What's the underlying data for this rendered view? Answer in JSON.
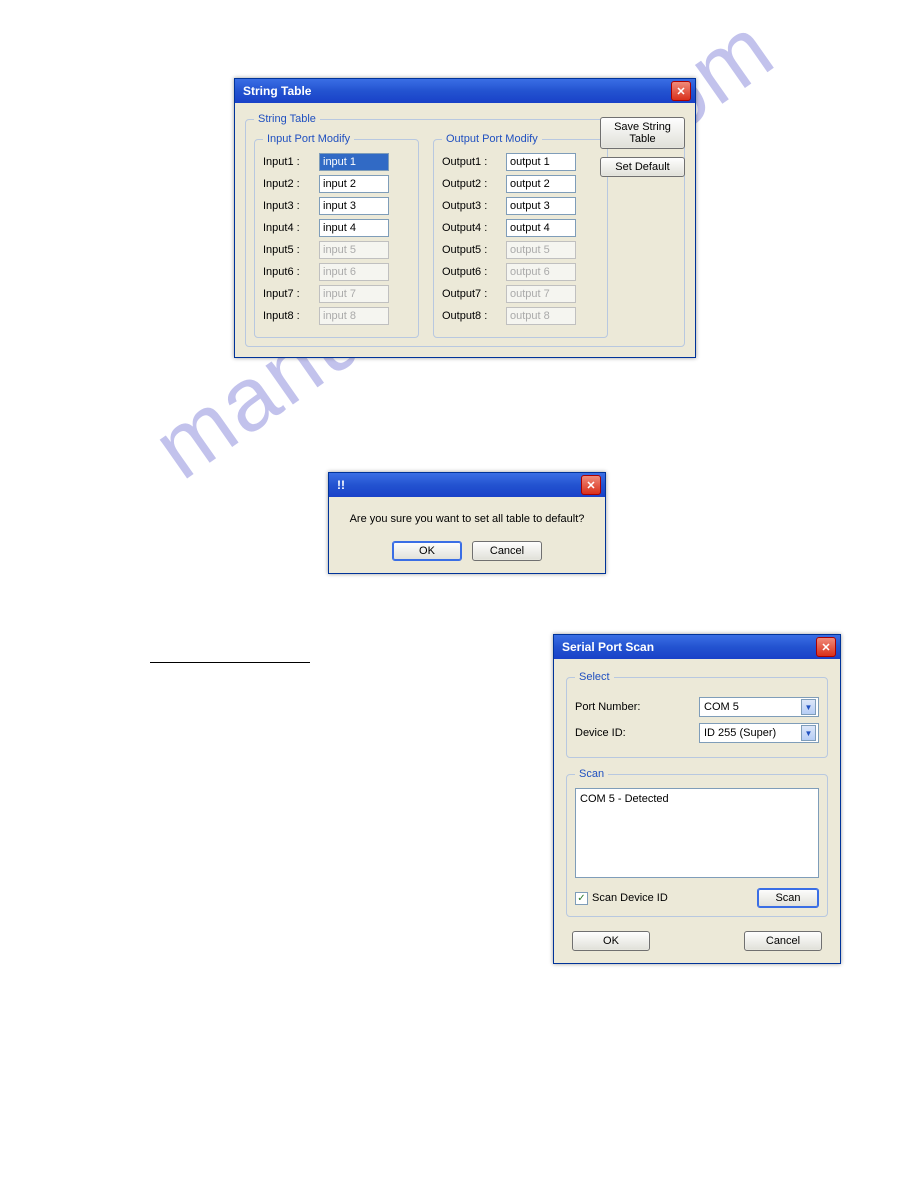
{
  "watermark": "manualshive.com",
  "string_table": {
    "title": "String Table",
    "group": "String Table",
    "input_group": "Input Port Modify",
    "output_group": "Output Port Modify",
    "inputs": [
      {
        "label": "Input1 :",
        "value": "input 1",
        "enabled": true,
        "selected": true
      },
      {
        "label": "Input2 :",
        "value": "input 2",
        "enabled": true,
        "selected": false
      },
      {
        "label": "Input3 :",
        "value": "input 3",
        "enabled": true,
        "selected": false
      },
      {
        "label": "Input4 :",
        "value": "input 4",
        "enabled": true,
        "selected": false
      },
      {
        "label": "Input5 :",
        "value": "input 5",
        "enabled": false,
        "selected": false
      },
      {
        "label": "Input6 :",
        "value": "input 6",
        "enabled": false,
        "selected": false
      },
      {
        "label": "Input7 :",
        "value": "input 7",
        "enabled": false,
        "selected": false
      },
      {
        "label": "Input8 :",
        "value": "input 8",
        "enabled": false,
        "selected": false
      }
    ],
    "outputs": [
      {
        "label": "Output1 :",
        "value": "output 1",
        "enabled": true
      },
      {
        "label": "Output2 :",
        "value": "output 2",
        "enabled": true
      },
      {
        "label": "Output3 :",
        "value": "output 3",
        "enabled": true
      },
      {
        "label": "Output4 :",
        "value": "output 4",
        "enabled": true
      },
      {
        "label": "Output5 :",
        "value": "output 5",
        "enabled": false
      },
      {
        "label": "Output6 :",
        "value": "output 6",
        "enabled": false
      },
      {
        "label": "Output7 :",
        "value": "output 7",
        "enabled": false
      },
      {
        "label": "Output8 :",
        "value": "output 8",
        "enabled": false
      }
    ],
    "save_button": "Save String Table",
    "default_button": "Set Default"
  },
  "confirm_dialog": {
    "title": "!!",
    "message": "Are you sure you want to set all table to default?",
    "ok": "OK",
    "cancel": "Cancel"
  },
  "serial_scan": {
    "title": "Serial Port Scan",
    "select_group": "Select",
    "port_label": "Port Number:",
    "port_value": "COM 5",
    "device_label": "Device ID:",
    "device_value": "ID 255 (Super)",
    "scan_group": "Scan",
    "scan_result": "COM 5 - Detected",
    "checkbox_label": "Scan Device ID",
    "checkbox_checked": true,
    "scan_button": "Scan",
    "ok": "OK",
    "cancel": "Cancel"
  }
}
